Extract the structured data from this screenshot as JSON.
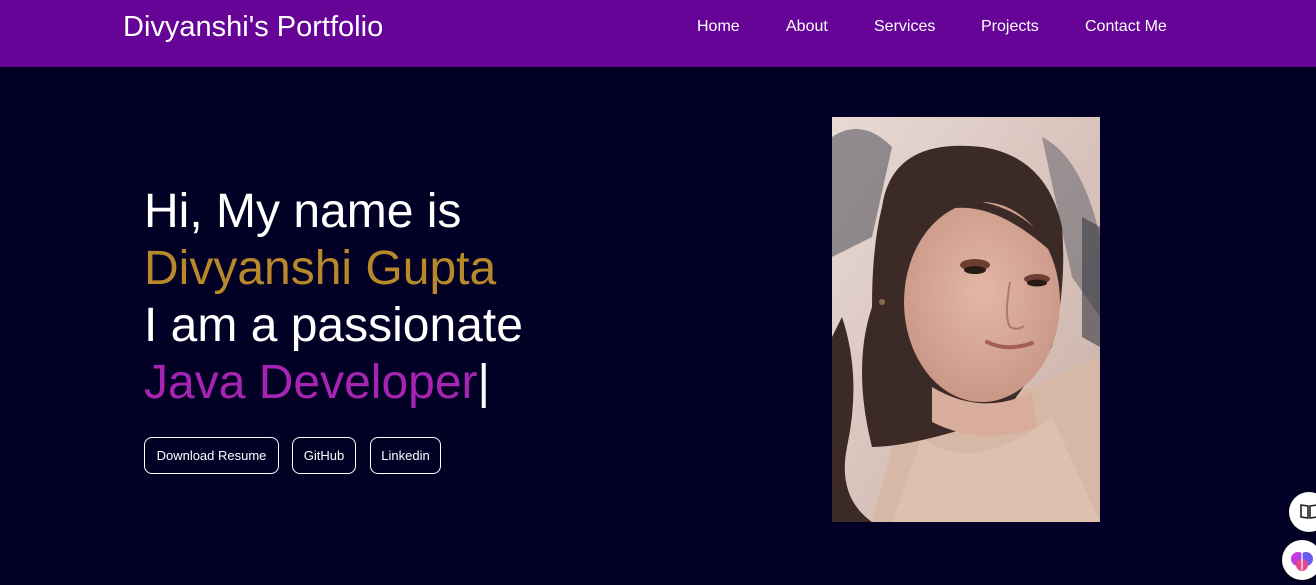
{
  "nav": {
    "brand": "Divyanshi's Portfolio",
    "links": [
      "Home",
      "About",
      "Services",
      "Projects",
      "Contact Me"
    ]
  },
  "hero": {
    "greeting": "Hi, My name is",
    "name": "Divyanshi Gupta",
    "tagline": "I am a passionate",
    "role": "Java Developer",
    "cursor": "|",
    "buttons": {
      "resume": "Download Resume",
      "github": "GitHub",
      "linkedin": "Linkedin"
    },
    "photo_icon": "profile-photo"
  },
  "floating": {
    "reader_icon": "book-icon",
    "assistant_icon": "brain-icon"
  },
  "colors": {
    "navbar": "#650496",
    "background": "#020024",
    "name_accent": "#b8892b",
    "role_accent": "#a724b3"
  }
}
